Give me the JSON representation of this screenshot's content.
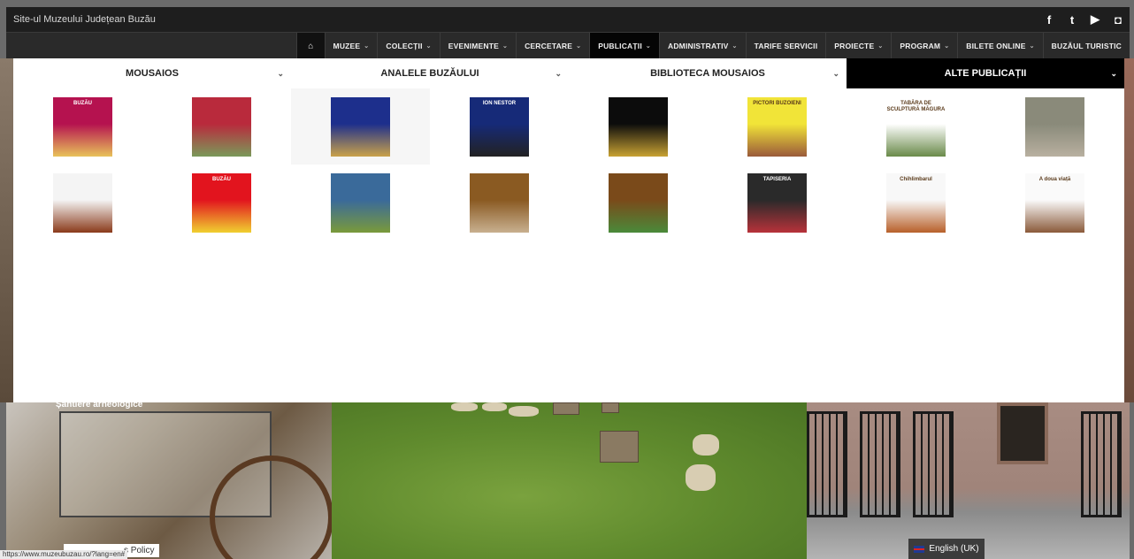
{
  "topbar": {
    "site_title": "Site-ul Muzeului Județean Buzău",
    "social": [
      {
        "icon": "facebook-icon",
        "glyph": "f"
      },
      {
        "icon": "twitter-icon",
        "glyph": "t"
      },
      {
        "icon": "youtube-icon",
        "glyph": "▶"
      },
      {
        "icon": "instagram-icon",
        "glyph": "◘"
      }
    ]
  },
  "nav": {
    "home_glyph": "⌂",
    "items": [
      {
        "label": "MUZEE",
        "caret": "⌄",
        "active": false
      },
      {
        "label": "COLECȚII",
        "caret": "⌄",
        "active": false
      },
      {
        "label": "EVENIMENTE",
        "caret": "⌄",
        "active": false
      },
      {
        "label": "CERCETARE",
        "caret": "⌄",
        "active": false
      },
      {
        "label": "PUBLICAȚII",
        "caret": "⌄",
        "active": true
      },
      {
        "label": "ADMINISTRATIV",
        "caret": "⌄",
        "active": false
      },
      {
        "label": "TARIFE SERVICII",
        "caret": "",
        "active": false
      },
      {
        "label": "PROIECTE",
        "caret": "⌄",
        "active": false
      },
      {
        "label": "PROGRAM",
        "caret": "⌄",
        "active": false
      },
      {
        "label": "BILETE ONLINE",
        "caret": "⌄",
        "active": false
      },
      {
        "label": "BUZĂUL TURISTIC",
        "caret": "",
        "active": false
      }
    ]
  },
  "mega": {
    "tabs": [
      {
        "label": "MOUSAIOS",
        "active": false
      },
      {
        "label": "ANALELE BUZĂULUI",
        "active": false
      },
      {
        "label": "BIBLIOTECA MOUSAIOS",
        "active": false
      },
      {
        "label": "ALTE PUBLICAȚII",
        "active": true
      }
    ],
    "chevron": "⌄",
    "books": [
      {
        "title": "BUZĂU",
        "bg": "#b5124f",
        "accent": "#e8c25a"
      },
      {
        "title": "",
        "bg": "#b92a3c",
        "accent": "#7a9a5a"
      },
      {
        "title": "",
        "bg": "#1d2f8c",
        "accent": "#c9a24a"
      },
      {
        "title": "ION NESTOR",
        "bg": "#162a78",
        "accent": "#222222"
      },
      {
        "title": "",
        "bg": "#0c0c0c",
        "accent": "#c8a233"
      },
      {
        "title": "PICTORI BUZOIENI",
        "bg": "#f1e438",
        "accent": "#9a5a3a"
      },
      {
        "title": "TABĂRA DE SCULPTURĂ MĂGURA",
        "bg": "#ffffff",
        "accent": "#6a8a4a"
      },
      {
        "title": "",
        "bg": "#8a8a7a",
        "accent": "#b8b0a0"
      },
      {
        "title": "",
        "bg": "#f4f4f4",
        "accent": "#8a3a1a"
      },
      {
        "title": "BUZĂU",
        "bg": "#e2141e",
        "accent": "#f0d030"
      },
      {
        "title": "",
        "bg": "#3a6a9a",
        "accent": "#7a9a3a"
      },
      {
        "title": "",
        "bg": "#8a5a22",
        "accent": "#c8b090"
      },
      {
        "title": "",
        "bg": "#7a4a1a",
        "accent": "#4a8a3a"
      },
      {
        "title": "TAPISERIA",
        "bg": "#2a2a2a",
        "accent": "#b8323a"
      },
      {
        "title": "Chihlimbarul",
        "bg": "#f8f8f8",
        "accent": "#b8602a"
      },
      {
        "title": "A doua viață",
        "bg": "#fafafa",
        "accent": "#8a5a3a"
      }
    ]
  },
  "background": {
    "caption": "Șantiere arheologice",
    "policy": "s Policy",
    "language": "English (UK)"
  },
  "status_url": "https://www.muzeubuzau.ro/?lang=en#"
}
